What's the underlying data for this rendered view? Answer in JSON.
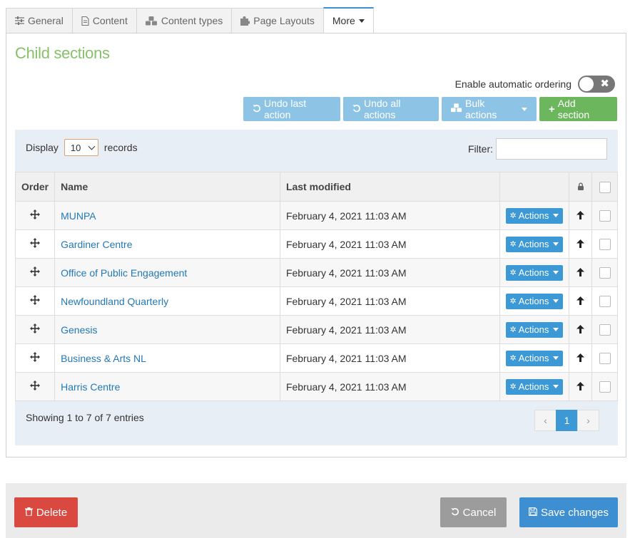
{
  "tabs": [
    {
      "label": "General",
      "icon": "sliders-icon"
    },
    {
      "label": "Content",
      "icon": "document-icon"
    },
    {
      "label": "Content types",
      "icon": "cubes-icon"
    },
    {
      "label": "Page Layouts",
      "icon": "puzzle-icon"
    },
    {
      "label": "More",
      "icon": "caret-down-icon",
      "active": true
    }
  ],
  "section_title": "Child sections",
  "auto_ordering": {
    "label": "Enable automatic ordering",
    "enabled": false,
    "toggle_glyph": "✖"
  },
  "toolbar": {
    "undo_last": "Undo last action",
    "undo_all": "Undo all actions",
    "bulk": "Bulk actions",
    "add": "Add section"
  },
  "table_controls": {
    "display_label": "Display",
    "page_size": "10",
    "records_label": "records",
    "filter_label": "Filter:",
    "filter_value": ""
  },
  "columns": {
    "order": "Order",
    "name": "Name",
    "modified": "Last modified"
  },
  "rows": [
    {
      "name": "MUNPA",
      "modified": "February 4, 2021 11:03 AM",
      "action": "Actions"
    },
    {
      "name": "Gardiner Centre",
      "modified": "February 4, 2021 11:03 AM",
      "action": "Actions"
    },
    {
      "name": "Office of Public Engagement",
      "modified": "February 4, 2021 11:03 AM",
      "action": "Actions"
    },
    {
      "name": "Newfoundland Quarterly",
      "modified": "February 4, 2021 11:03 AM",
      "action": "Actions"
    },
    {
      "name": "Genesis",
      "modified": "February 4, 2021 11:03 AM",
      "action": "Actions"
    },
    {
      "name": "Business & Arts NL",
      "modified": "February 4, 2021 11:03 AM",
      "action": "Actions"
    },
    {
      "name": "Harris Centre",
      "modified": "February 4, 2021 11:03 AM",
      "action": "Actions"
    }
  ],
  "showing": "Showing 1 to 7 of 7 entries",
  "pager": {
    "prev": "‹",
    "current": "1",
    "next": "›"
  },
  "footer": {
    "delete": "Delete",
    "cancel": "Cancel",
    "save": "Save changes"
  },
  "colors": {
    "accent": "#3d99d6",
    "title_green": "#86c06b",
    "delete_red": "#d9493f",
    "add_green": "#6cb65e"
  }
}
